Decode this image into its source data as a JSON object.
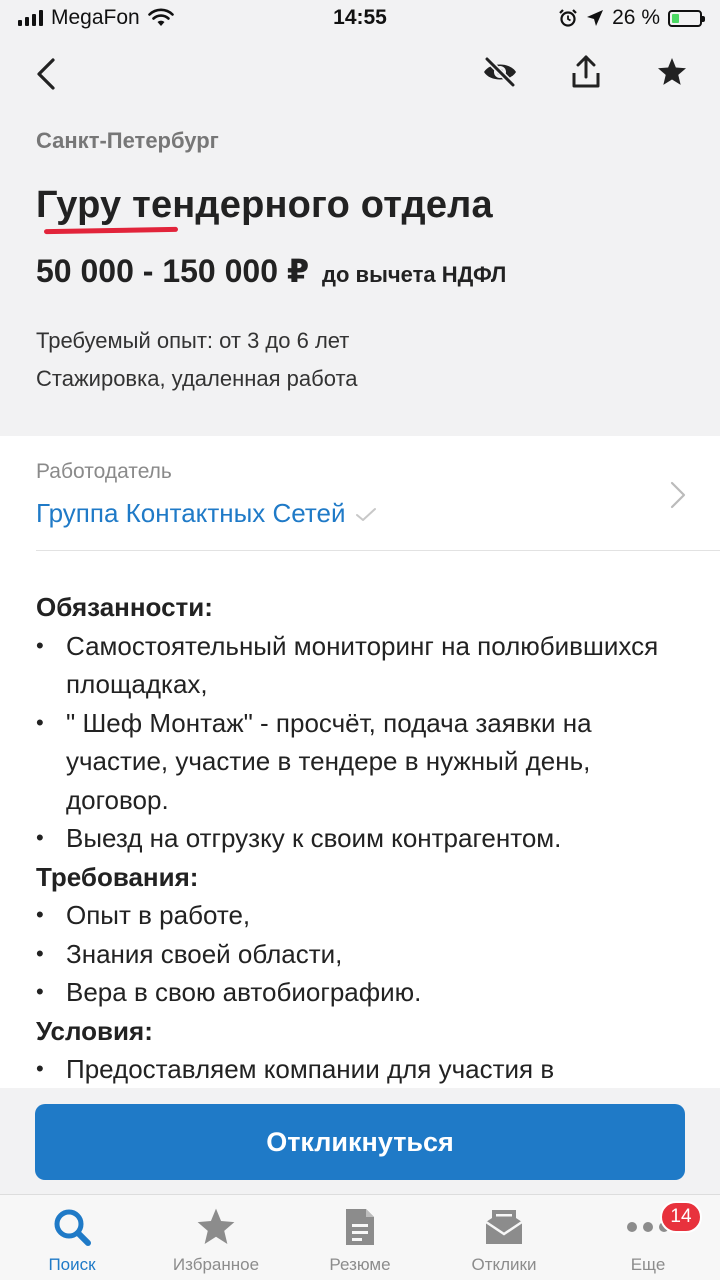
{
  "status_bar": {
    "carrier": "MegaFon",
    "time": "14:55",
    "battery_percent": "26 %",
    "battery_level": 0.26
  },
  "nav": {
    "icons": [
      "back-chevron-icon",
      "eye-slash-icon",
      "share-icon",
      "star-icon"
    ]
  },
  "vacancy": {
    "city": "Санкт-Петербург",
    "title": "Гуру тендерного отдела",
    "salary": "50 000 - 150 000 ₽",
    "salary_note": "до вычета НДФЛ",
    "experience": "Требуемый опыт: от 3 до 6 лет",
    "employment": "Стажировка, удаленная работа"
  },
  "employer": {
    "label": "Работодатель",
    "name": "Группа Контактных Сетей"
  },
  "description": {
    "duties_title": "Обязанности:",
    "duties": [
      "Самостоятельный мониторинг на полюбившихся площадках,",
      "\" Шеф Монтаж\" - просчёт, подача заявки на участие, участие в тендере в нужный день, договор.",
      "Выезд на отгрузку к своим контрагентом."
    ],
    "requirements_title": "Требования:",
    "requirements": [
      "Опыт в работе,",
      "Знания своей области,",
      "Вера в свою автобиографию."
    ],
    "conditions_title": "Условия:",
    "conditions": [
      "Предоставляем компании для участия в"
    ]
  },
  "apply_button": "Откликнуться",
  "tabs": [
    {
      "label": "Поиск",
      "icon": "search-icon",
      "active": true
    },
    {
      "label": "Избранное",
      "icon": "star-icon",
      "active": false
    },
    {
      "label": "Резюме",
      "icon": "document-icon",
      "active": false
    },
    {
      "label": "Отклики",
      "icon": "inbox-icon",
      "active": false
    },
    {
      "label": "Еще",
      "icon": "more-icon",
      "active": false,
      "badge": "14"
    }
  ],
  "colors": {
    "accent": "#1f7ac7",
    "badge": "#e8323d",
    "underline": "#e2243a"
  }
}
